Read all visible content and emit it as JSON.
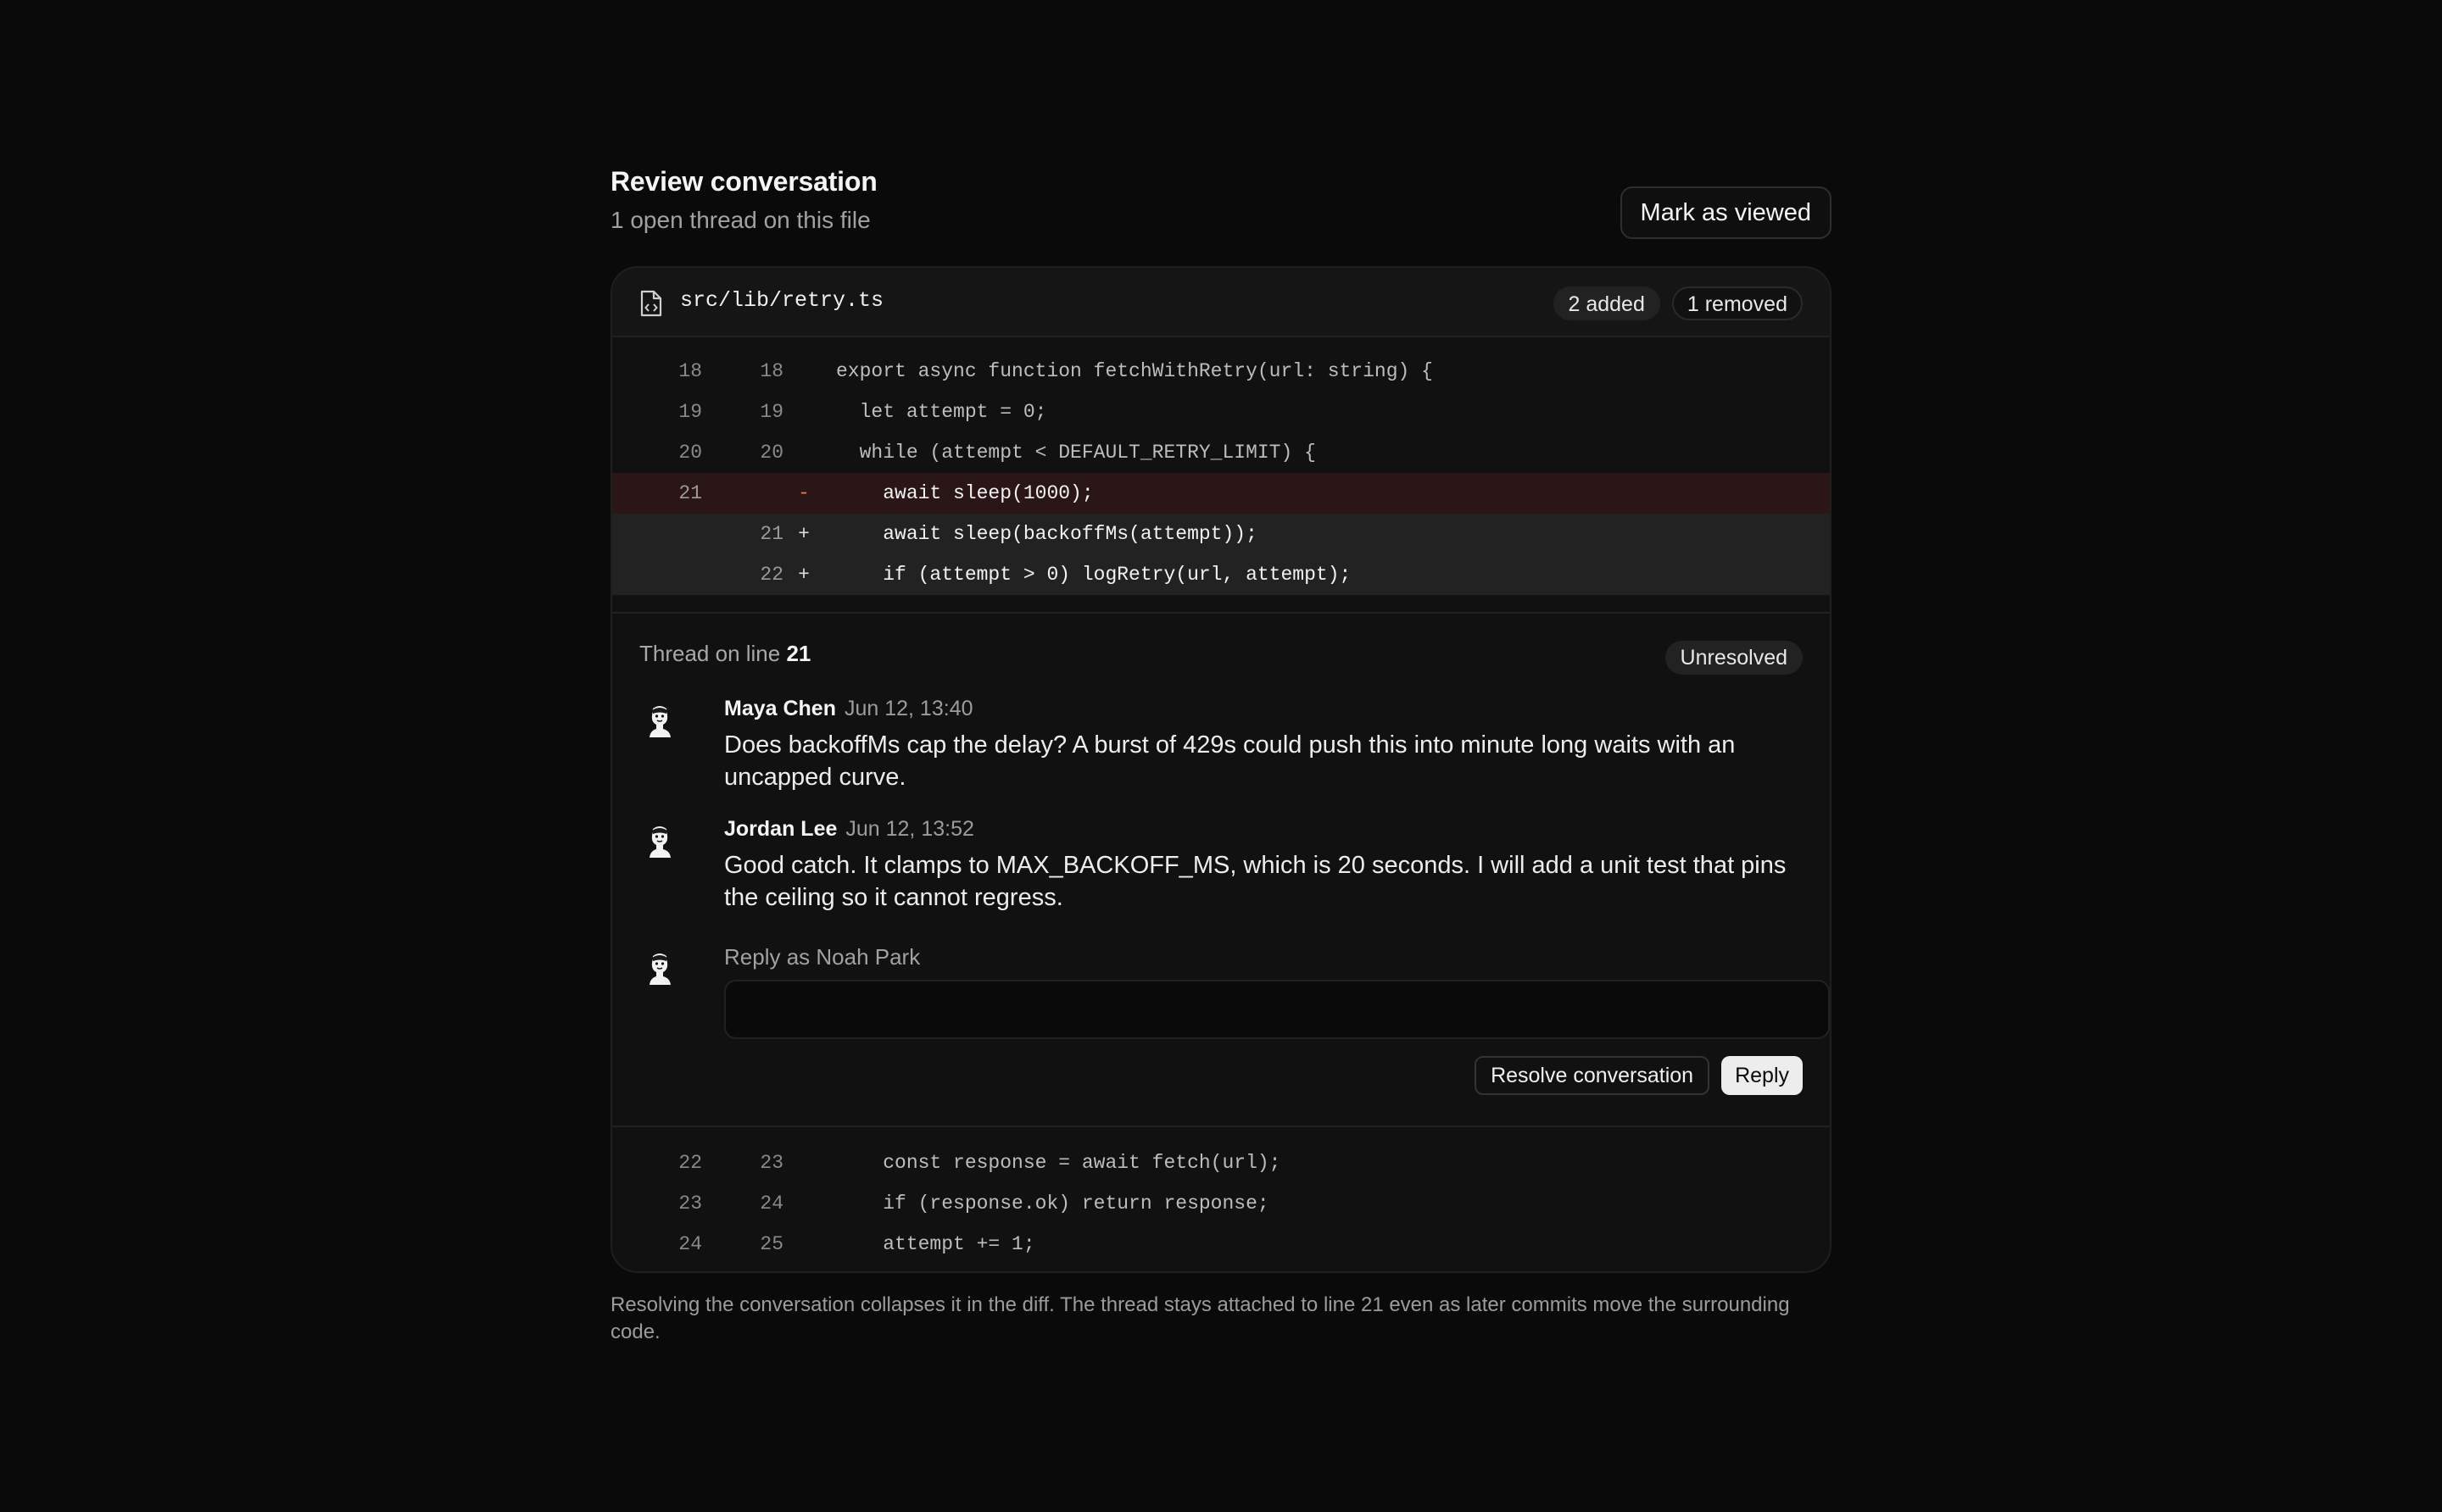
{
  "header": {
    "title": "Review conversation",
    "subtitle": "1 open thread on this file",
    "mark_viewed_label": "Mark as viewed"
  },
  "file": {
    "path": "src/lib/retry.ts",
    "added_label": "2 added",
    "removed_label": "1 removed"
  },
  "diff_top": [
    {
      "old": "18",
      "new": "18",
      "sign": "",
      "type": "context",
      "text": "export async function fetchWithRetry(url: string) {"
    },
    {
      "old": "19",
      "new": "19",
      "sign": "",
      "type": "context",
      "text": "  let attempt = 0;"
    },
    {
      "old": "20",
      "new": "20",
      "sign": "",
      "type": "context",
      "text": "  while (attempt < DEFAULT_RETRY_LIMIT) {"
    },
    {
      "old": "21",
      "new": "",
      "sign": "-",
      "type": "removed",
      "text": "    await sleep(1000);"
    },
    {
      "old": "",
      "new": "21",
      "sign": "+",
      "type": "added",
      "text": "    await sleep(backoffMs(attempt));"
    },
    {
      "old": "",
      "new": "22",
      "sign": "+",
      "type": "added",
      "text": "    if (attempt > 0) logRetry(url, attempt);"
    }
  ],
  "thread": {
    "prefix": "Thread on line ",
    "line": "21",
    "status": "Unresolved",
    "comments": [
      {
        "author": "Maya Chen",
        "time": "Jun 12, 13:40",
        "body": "Does backoffMs cap the delay? A burst of 429s could push this into minute long waits with an uncapped curve."
      },
      {
        "author": "Jordan Lee",
        "time": "Jun 12, 13:52",
        "body": "Good catch. It clamps to MAX_BACKOFF_MS, which is 20 seconds. I will add a unit test that pins the ceiling so it cannot regress."
      }
    ],
    "reply_label": "Reply as Noah Park",
    "reply_value": "",
    "resolve_label": "Resolve conversation",
    "reply_button": "Reply"
  },
  "diff_bottom": [
    {
      "old": "22",
      "new": "23",
      "sign": "",
      "type": "context",
      "text": "    const response = await fetch(url);"
    },
    {
      "old": "23",
      "new": "24",
      "sign": "",
      "type": "context",
      "text": "    if (response.ok) return response;"
    },
    {
      "old": "24",
      "new": "25",
      "sign": "",
      "type": "context",
      "text": "    attempt += 1;"
    }
  ],
  "footnote": "Resolving the conversation collapses it in the diff. The thread stays attached to line 21 even as later commits move the surrounding code.",
  "icons": {
    "file": "file-code-icon",
    "avatar": "avatar-icon"
  },
  "colors": {
    "background": "#0a0a0a",
    "card": "#111111",
    "removed_row": "#2a1616",
    "added_row": "#222222",
    "removed_sign": "#e07a4f"
  }
}
